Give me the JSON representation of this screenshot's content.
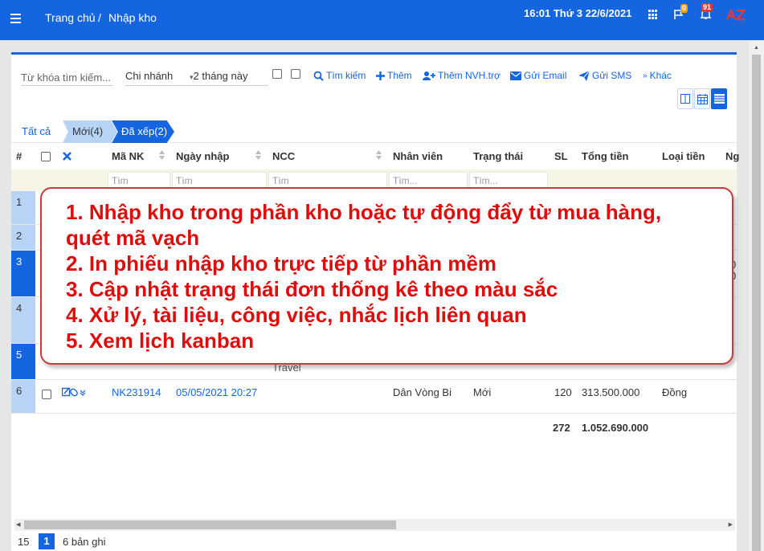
{
  "header": {
    "breadcrumb_home": "Trang chủ",
    "breadcrumb_sep": "/",
    "breadcrumb_page": "Nhập kho",
    "datetime": "16:01  Thứ 3 22/6/2021",
    "flag_badge": "0",
    "bell_badge": "91",
    "logo_text": "AZ",
    "accent": "#1565e0"
  },
  "toolbar": {
    "search_placeholder": "Từ khóa tìm kiếm...",
    "branch": "Chi nhánh",
    "period": "2 tháng này",
    "search_btn": "Tìm kiếm",
    "add_btn": "Thêm",
    "add_supplier_btn": "Thêm NVH.trợ",
    "email_btn": "Gửi Email",
    "sms_btn": "Gửi SMS",
    "more_btn": "Khác"
  },
  "tabs": {
    "all": "Tất cả",
    "new": "Mới(4)",
    "done": "Đã xếp(2)"
  },
  "table": {
    "columns": {
      "num": "#",
      "code": "Mã NK",
      "date": "Ngày nhập",
      "supplier": "NCC",
      "staff": "Nhân viên",
      "status": "Trạng thái",
      "qty": "SL",
      "total": "Tổng tiền",
      "currency": "Loại tiền",
      "extra": "Ng"
    },
    "filter_placeholder": "Tìm",
    "filter_placeholder_more": "Tìm...",
    "row_numbers": [
      "1",
      "2",
      "3",
      "4",
      "5",
      "6"
    ],
    "row3_right_a": "0",
    "row3_right_b": "0",
    "row5_supplier": "Travel",
    "row6": {
      "code": "NK231914",
      "date": "05/05/2021 20:27",
      "staff": "Dân Vòng Bi",
      "status": "Mới",
      "qty": "120",
      "total": "313.500.000",
      "currency": "Đồng"
    },
    "sum_qty": "272",
    "sum_total": "1.052.690.000"
  },
  "callout": {
    "line1": "1. Nhập kho trong phần kho hoặc tự động đẩy từ mua hàng,",
    "line2": "quét mã vạch",
    "line3": "2. In phiếu nhập kho trực tiếp từ phần mềm",
    "line4": "3. Cập nhật trạng thái đơn thống kê theo màu sắc",
    "line5": "4. Xử lý, tài liệu, công việc, nhắc lịch liên quan",
    "line6": "5. Xem lịch kanban"
  },
  "pager": {
    "page_size": "15",
    "current_page": "1",
    "record_count": "6 bản ghi"
  }
}
